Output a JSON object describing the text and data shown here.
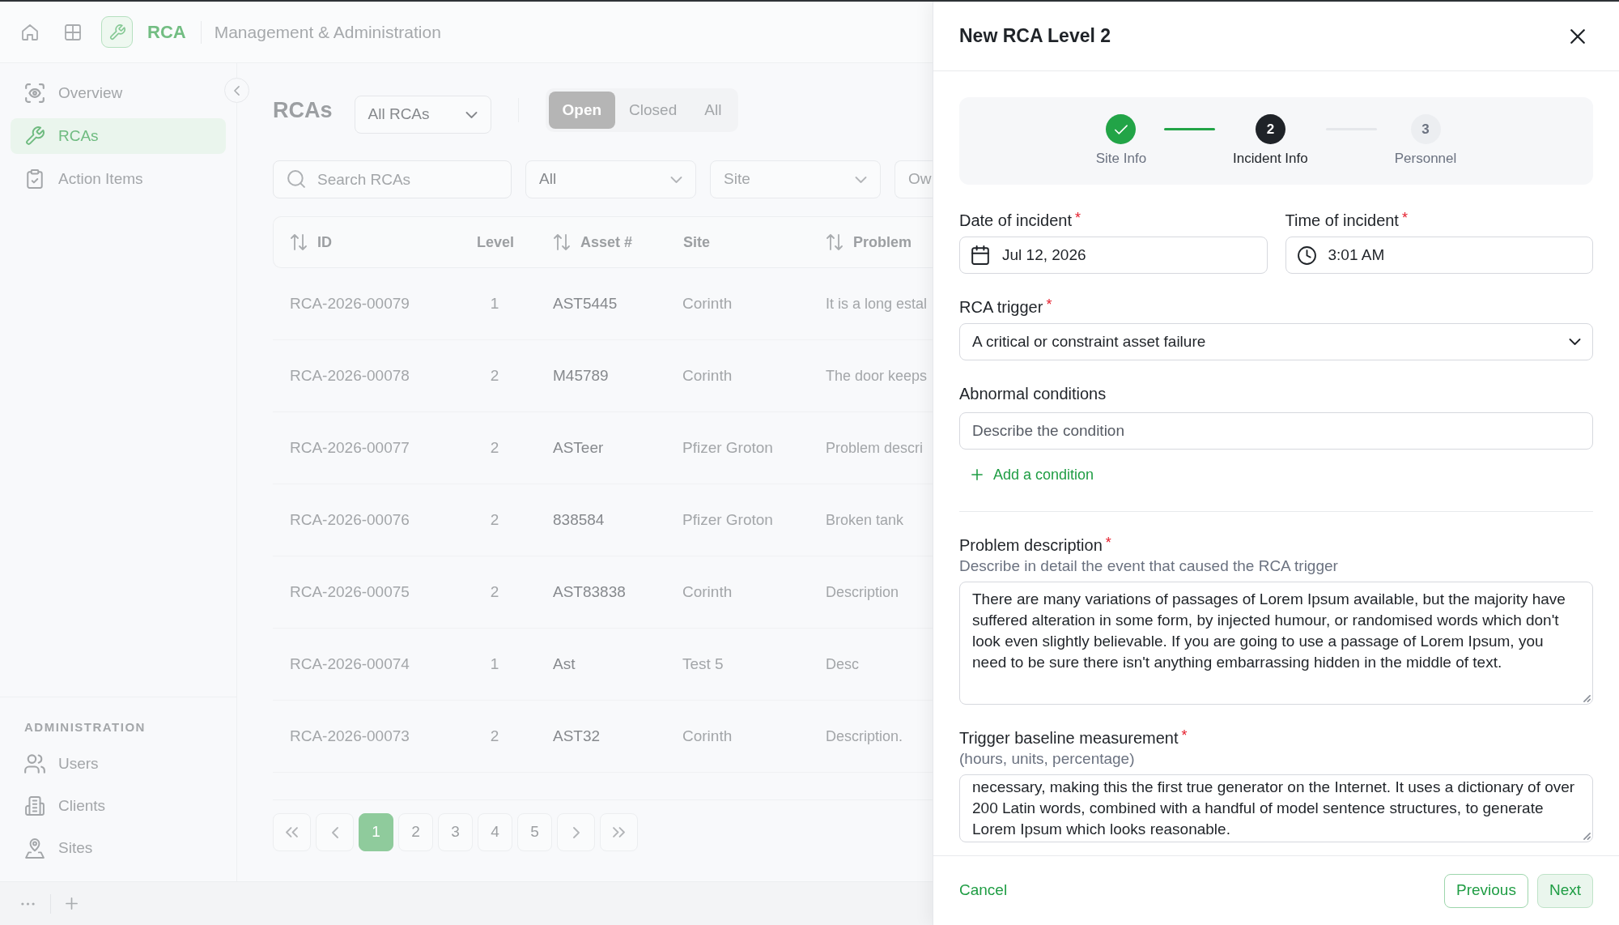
{
  "header": {
    "app_name": "RCA",
    "section_title": "Management & Administration"
  },
  "sidebar": {
    "nav_items": [
      {
        "label": "Overview",
        "selected": false
      },
      {
        "label": "RCAs",
        "selected": true
      },
      {
        "label": "Action Items",
        "selected": false
      }
    ],
    "admin_section": {
      "heading": "ADMINISTRATION",
      "items": [
        {
          "label": "Users",
          "selected": false
        },
        {
          "label": "Clients",
          "selected": false
        },
        {
          "label": "Sites",
          "selected": false
        }
      ]
    }
  },
  "rca_list": {
    "title": "RCAs",
    "scope_select": {
      "value": "All RCAs"
    },
    "status_tabs": [
      {
        "label": "Open",
        "selected": true
      },
      {
        "label": "Closed",
        "selected": false
      },
      {
        "label": "All",
        "selected": false
      }
    ],
    "search": {
      "placeholder": "Search RCAs"
    },
    "filters": [
      {
        "value": "All",
        "truncated": false
      },
      {
        "placeholder": "Site",
        "truncated": false
      },
      {
        "placeholder": "Ow",
        "truncated": true
      }
    ],
    "table": {
      "columns": [
        {
          "label": "ID",
          "sortable": true
        },
        {
          "label": "Level",
          "sortable": false
        },
        {
          "label": "Asset #",
          "sortable": true
        },
        {
          "label": "Site",
          "sortable": false
        },
        {
          "label": "Problem",
          "sortable": true
        }
      ],
      "rows": [
        [
          "RCA-2026-00079",
          "1",
          "AST5445",
          "Corinth",
          "It is a long estal"
        ],
        [
          "RCA-2026-00078",
          "2",
          "M45789",
          "Corinth",
          "The door keeps"
        ],
        [
          "RCA-2026-00077",
          "2",
          "ASTeer",
          "Pfizer Groton",
          "Problem descri"
        ],
        [
          "RCA-2026-00076",
          "2",
          "838584",
          "Pfizer Groton",
          "Broken tank"
        ],
        [
          "RCA-2026-00075",
          "2",
          "AST83838",
          "Corinth",
          "Description"
        ],
        [
          "RCA-2026-00074",
          "1",
          "Ast",
          "Test 5",
          "Desc"
        ],
        [
          "RCA-2026-00073",
          "2",
          "AST32",
          "Corinth",
          "Description."
        ]
      ]
    },
    "pagination": {
      "pages": [
        {
          "label": "1",
          "selected": true
        },
        {
          "label": "2",
          "selected": false
        },
        {
          "label": "3",
          "selected": false
        },
        {
          "label": "4",
          "selected": false
        },
        {
          "label": "5",
          "selected": false
        }
      ]
    }
  },
  "drawer": {
    "title": "New RCA Level 2",
    "steps": [
      {
        "label": "Site Info",
        "completed": true,
        "selected": false
      },
      {
        "number": "2",
        "label": "Incident Info",
        "completed": false,
        "selected": true
      },
      {
        "number": "3",
        "label": "Personnel",
        "completed": false,
        "selected": false
      }
    ],
    "sections": [
      {
        "rows": [
          [
            {
              "kind": "date",
              "label": "Date of incident",
              "required_mark": "*",
              "value": "Jul 12, 2026"
            },
            {
              "kind": "time",
              "label": "Time of incident",
              "required_mark": "*",
              "value": "3:01 AM"
            }
          ],
          [
            {
              "kind": "select",
              "label": "RCA trigger",
              "required_mark": "*",
              "value": "A critical or constraint asset failure"
            }
          ],
          [
            {
              "kind": "text",
              "label": "Abnormal conditions",
              "placeholder": "Describe the condition",
              "add_action": "Add a condition"
            }
          ]
        ]
      },
      {
        "rows": [
          [
            {
              "kind": "textarea",
              "label": "Problem description",
              "required_mark": "*",
              "hint": "Describe in detail the event that caused the RCA trigger",
              "value": "There are many variations of passages of Lorem Ipsum available, but the majority have suffered alteration in some form, by injected humour, or randomised words which don't look even slightly believable. If you are going to use a passage of Lorem Ipsum, you need to be sure there isn't anything embarrassing hidden in the middle of text."
            }
          ],
          [
            {
              "kind": "textarea",
              "label": "Trigger baseline measurement",
              "required_mark": "*",
              "hint": "(hours, units, percentage)",
              "value": "necessary, making this the first true generator on the Internet. It uses a dictionary of over 200 Latin words, combined with a handful of model sentence structures, to generate Lorem Ipsum which looks reasonable."
            }
          ]
        ]
      }
    ],
    "footer": {
      "cancel": "Cancel",
      "previous": "Previous",
      "next": "Next"
    }
  }
}
